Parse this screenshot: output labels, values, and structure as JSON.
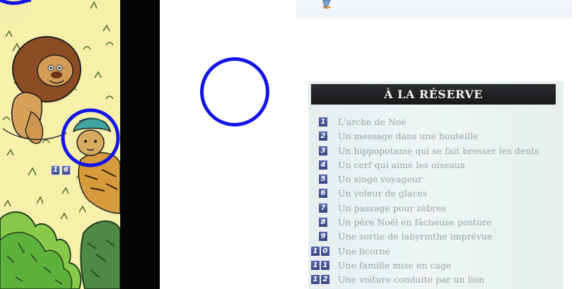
{
  "colors": {
    "highlight_circle": "#1414e6",
    "panel_background": "#eef5f5",
    "header_background": "#1f2022",
    "number_box": "#4a579b",
    "list_text": "#9aa3a6",
    "art_background": "#f5efab"
  },
  "scene": {
    "badge_digits": [
      "1",
      "6"
    ]
  },
  "reserve": {
    "title": "À LA RÉSERVE",
    "items": [
      {
        "digits": [
          "1"
        ],
        "label": "L'arche de Noé"
      },
      {
        "digits": [
          "2"
        ],
        "label": "Un message dans une bouteille"
      },
      {
        "digits": [
          "3"
        ],
        "label": "Un hippopotame qui se fait brosser les dents"
      },
      {
        "digits": [
          "4"
        ],
        "label": "Un cerf qui aime les oiseaux"
      },
      {
        "digits": [
          "5"
        ],
        "label": "Un singe voyageur"
      },
      {
        "digits": [
          "6"
        ],
        "label": "Un voleur de glaces"
      },
      {
        "digits": [
          "7"
        ],
        "label": "Un passage pour zèbres"
      },
      {
        "digits": [
          "8"
        ],
        "label": "Un père Noël en fâcheuse posture"
      },
      {
        "digits": [
          "9"
        ],
        "label": "Une sortie de labyrinthe imprévue"
      },
      {
        "digits": [
          "1",
          "0"
        ],
        "label": "Une licorne"
      },
      {
        "digits": [
          "1",
          "1"
        ],
        "label": "Une famille mise en cage"
      },
      {
        "digits": [
          "1",
          "2"
        ],
        "label": "Une voiture conduite par un lion"
      }
    ]
  }
}
